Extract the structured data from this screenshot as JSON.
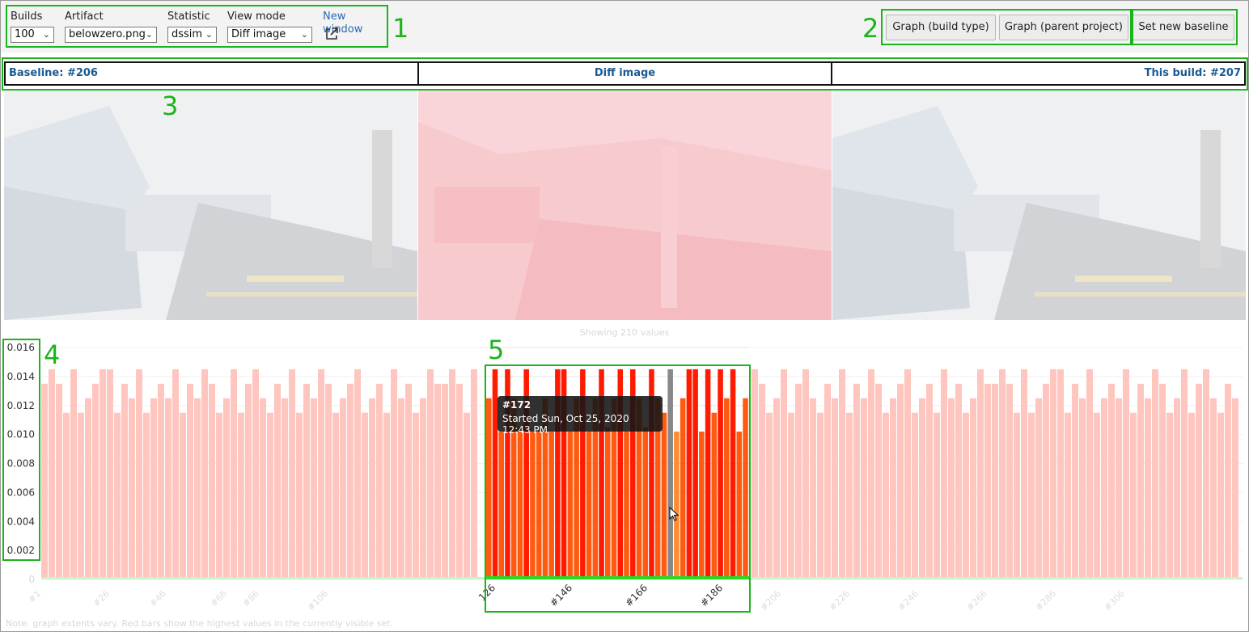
{
  "toolbar": {
    "builds": {
      "label": "Builds",
      "value": "100"
    },
    "artifact": {
      "label": "Artifact",
      "value": "belowzero.png"
    },
    "statistic": {
      "label": "Statistic",
      "value": "dssim"
    },
    "view_mode": {
      "label": "View mode",
      "value": "Diff image"
    },
    "new_window": "New window",
    "buttons": {
      "graph_build_type": "Graph (build type)",
      "graph_parent_project": "Graph (parent project)",
      "set_new_baseline": "Set new baseline"
    }
  },
  "images": {
    "baseline": "Baseline: #206",
    "diff": "Diff image",
    "this_build": "This build: #207"
  },
  "callouts": [
    "1",
    "2",
    "3",
    "4",
    "5"
  ],
  "chart_data": {
    "type": "bar",
    "caption": "Showing 210 values",
    "footnote": "Note: graph extents vary. Red bars show the highest values in the currently visible set.",
    "yticks": [
      "0",
      "0.002",
      "0.004",
      "0.006",
      "0.008",
      "0.010",
      "0.012",
      "0.014",
      "0.016"
    ],
    "ylim": [
      0,
      0.016
    ],
    "xticks_faint": [
      "#1",
      "#26",
      "#46",
      "#66",
      "#86",
      "#106",
      "#206",
      "#226",
      "#246",
      "#266",
      "#286",
      "#306"
    ],
    "xticks_focus": [
      "126",
      "#146",
      "#166",
      "#186"
    ],
    "colors": {
      "high": "#ff1a00",
      "mid": "#ff5a10",
      "low": "#ff8c30",
      "selected": "#888888",
      "baseline_line": "#22dd22"
    },
    "focus_window": {
      "values": [
        0.0125,
        0.0145,
        0.0102,
        0.0145,
        0.0125,
        0.0105,
        0.0145,
        0.0102,
        0.0102,
        0.0125,
        0.0102,
        0.0145,
        0.0145,
        0.0102,
        0.0125,
        0.0145,
        0.0102,
        0.0125,
        0.0145,
        0.0105,
        0.0125,
        0.0145,
        0.0102,
        0.0145,
        0.0125,
        0.0105,
        0.0145,
        0.0125,
        0.0115,
        0.0145,
        0.0102,
        0.0125,
        0.0145,
        0.0145,
        0.0102,
        0.0145,
        0.0115,
        0.0145,
        0.0125,
        0.0145,
        0.0102,
        0.0125
      ],
      "selected_index": 29,
      "tooltip": {
        "title": "#172",
        "text": "Started Sun, Oct 25, 2020 12:43 PM"
      }
    },
    "faded_values": [
      0.0135,
      0.0145,
      0.0135,
      0.0115,
      0.0145,
      0.0115,
      0.0125,
      0.0135,
      0.0145,
      0.0145,
      0.0115,
      0.0135,
      0.0125,
      0.0145,
      0.0115,
      0.0125,
      0.0135,
      0.0125,
      0.0145,
      0.0115,
      0.0135,
      0.0125,
      0.0145,
      0.0135,
      0.0115,
      0.0125,
      0.0145,
      0.0115,
      0.0135,
      0.0145,
      0.0125,
      0.0115,
      0.0135,
      0.0125,
      0.0145,
      0.0115,
      0.0135,
      0.0125,
      0.0145,
      0.0135,
      0.0115,
      0.0125,
      0.0135,
      0.0145,
      0.0115,
      0.0125,
      0.0135,
      0.0115,
      0.0145,
      0.0125,
      0.0135,
      0.0115,
      0.0125,
      0.0145,
      0.0135
    ]
  }
}
